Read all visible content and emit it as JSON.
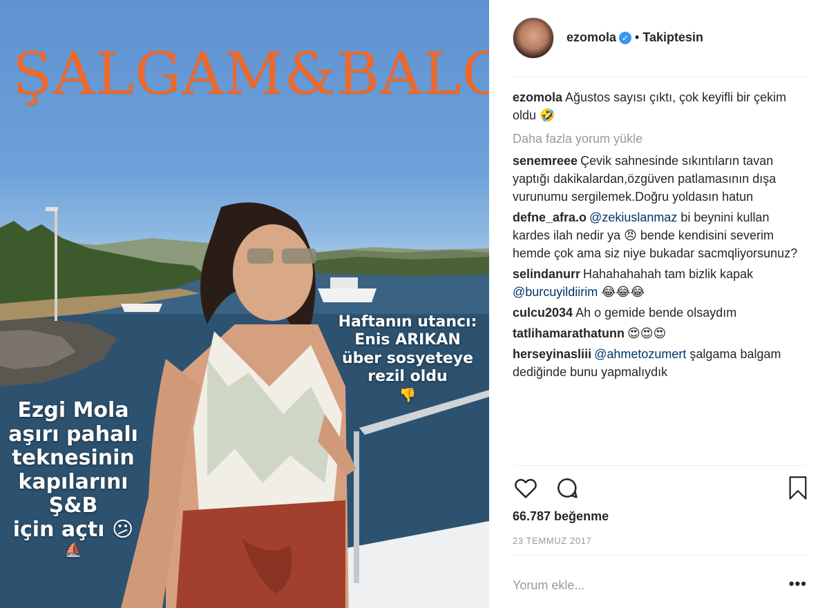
{
  "cover": {
    "title": "ŞALGAM&BALGAM",
    "headline_right": [
      "Haftanın utancı:",
      "Enis ARIKAN",
      "über sosyeteye",
      "rezil oldu"
    ],
    "headline_right_emoji": "👎",
    "headline_left": [
      "Ezgi Mola",
      "aşırı pahalı",
      "teknesinin",
      "kapılarını",
      "Ş&B"
    ],
    "headline_left_last": "için açtı",
    "headline_left_emoji": "😕",
    "headline_left_emoji2": "⛵"
  },
  "post": {
    "username": "ezomola",
    "verified_icon": "verified-badge-icon",
    "separator": "•",
    "follow_status": "Takiptesin",
    "caption": {
      "user": "ezomola",
      "text": "Ağustos sayısı çıktı, çok keyifli bir çekim oldu 🤣"
    },
    "load_more": "Daha fazla yorum yükle",
    "comments": [
      {
        "user": "senemreee",
        "mention": "",
        "text": "Çevik sahnesinde sıkıntıların tavan yaptığı dakikalardan,özgüven patlamasının dışa vurunumu sergilemek.Doğru yoldasın hatun"
      },
      {
        "user": "defne_afra.o",
        "mention": "@zekiuslanmaz",
        "text": "bi beynini kullan kardes ilah nedir ya 😠 bende kendisini severim hemde çok ama siz niye bukadar sacmqliyorsunuz?"
      },
      {
        "user": "selindanurr",
        "mention": "",
        "text": "Hahahahahah tam bizlik kapak",
        "mention_after": "@burcuyildiirim",
        "text_after": "😂😂😂"
      },
      {
        "user": "culcu2034",
        "mention": "",
        "text": "Ah o gemide bende olsaydım"
      },
      {
        "user": "tatlihamarathatunn",
        "mention": "",
        "text": "😍😍😍"
      },
      {
        "user": "herseyinasliii",
        "mention": "@ahmetozumert",
        "text": "şalgama balgam dediğinde bunu yapmalıydık"
      }
    ],
    "likes": "66.787 beğenme",
    "date": "23 TEMMUZ 2017",
    "comment_placeholder": "Yorum ekle...",
    "more_options": "•••",
    "icons": {
      "like": "heart-icon",
      "comment": "comment-bubble-icon",
      "save": "bookmark-icon"
    }
  }
}
